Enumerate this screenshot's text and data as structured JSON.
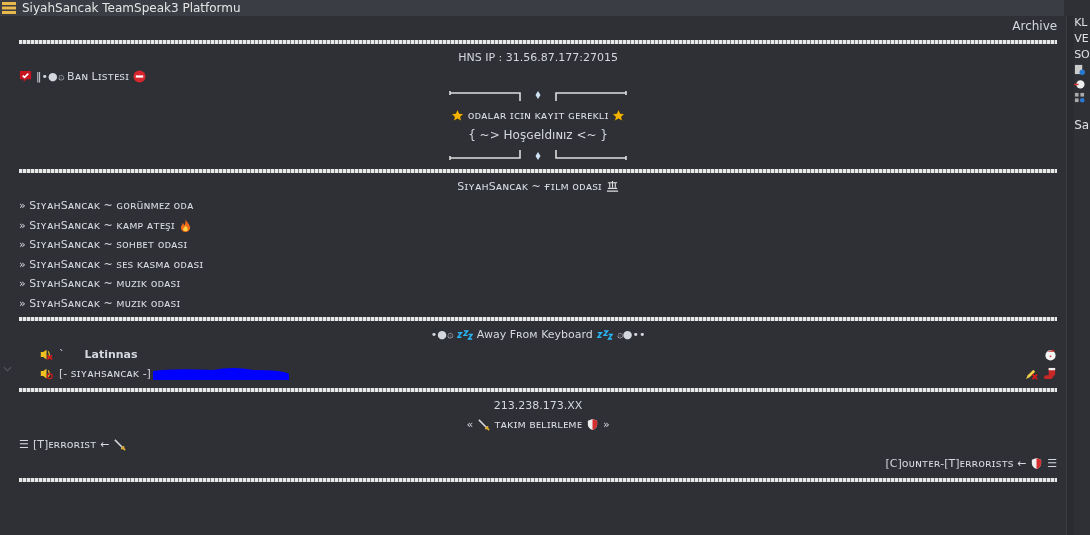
{
  "window": {
    "title": "SiyahSancak TeamSpeak3 Platformu"
  },
  "archive_link": "Archive",
  "hns_ip": "HNS IP : 31.56.87.177:27015",
  "ban_list": {
    "prefix": "‖•●۞",
    "label": "Bᴀɴ Lɪsᴛᴇsɪ"
  },
  "notice": "ᴏᴅᴀʟᴀʀ ɪᴄɪɴ ᴋᴀʏɪᴛ ɢᴇʀᴇᴋʟɪ",
  "welcome": "{ ~> Hoşɢeldıɴız <~ }",
  "film_room": "SɪʏᴀʜSᴀɴᴄᴀᴋ ~ ғɪʟᴍ ᴏᴅᴀsɪ",
  "rooms": [
    {
      "label": "» SɪʏᴀʜSᴀɴᴄᴀᴋ ~ ɢᴏʀüɴᴍᴇᴢ ᴏᴅᴀ",
      "kind": "plain"
    },
    {
      "label": "» SɪʏᴀʜSᴀɴᴄᴀᴋ ~ ᴋᴀᴍᴘ ᴀᴛᴇşɪ",
      "kind": "fire"
    },
    {
      "label": "» SɪʏᴀʜSᴀɴᴄᴀᴋ ~ sᴏʜʙᴇᴛ ᴏᴅᴀsɪ",
      "kind": "plain"
    },
    {
      "label": "» SɪʏᴀʜSᴀɴᴄᴀᴋ ~ sᴇs ᴋᴀsᴍᴀ ᴏᴅᴀsɪ",
      "kind": "plain"
    },
    {
      "label": "» SɪʏᴀʜSᴀɴᴄᴀᴋ ~ ᴍᴜᴢɪᴋ ᴏᴅᴀsɪ",
      "kind": "plain"
    },
    {
      "label": "» SɪʏᴀʜSᴀɴᴄᴀᴋ ~ ᴍᴜᴢɪᴋ ᴏᴅᴀsɪ",
      "kind": "plain"
    }
  ],
  "afk": {
    "prefix": "•●۞",
    "label": "Away Fʀᴏᴍ Keyboard",
    "suffix": "۞●••"
  },
  "clients": [
    {
      "prefix": "`",
      "name": "Latinnas",
      "kind": "muted",
      "redacted": false
    },
    {
      "name": "[- sɪʏᴀʜsᴀɴᴄᴀᴋ -]",
      "kind": "away",
      "redacted": true
    }
  ],
  "server_ip": "213.238.173.XX",
  "team_select": {
    "open": "«",
    "label": "ᴛᴀᴋɪᴍ ʙᴇʟɪʀʟᴇᴍᴇ",
    "close": "»"
  },
  "terrorist": {
    "menu": "☰",
    "label": "[T]ᴇʀʀᴏʀɪsᴛ ←"
  },
  "counter_terrorist": {
    "label": "[C]ᴏᴜɴᴛᴇʀ-[T]ᴇʀʀᴏʀɪsᴛs ←",
    "menu": "☰"
  },
  "side_panel": {
    "lines": [
      "KL",
      "VE",
      "SO"
    ],
    "section": "Sa"
  }
}
